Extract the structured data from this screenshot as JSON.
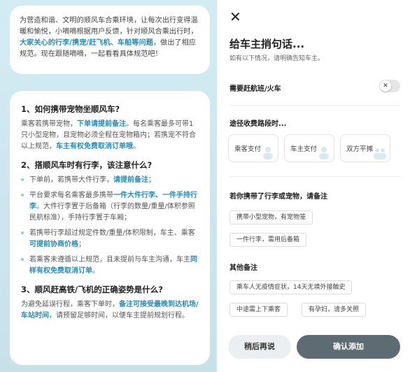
{
  "left": {
    "intro_parts": [
      "为营造和谐、文明的顺风车合乘环境，让每次出行变得温暖和愉悦，小嘀嘀根据用户反馈，针对顺风合乘出行时，",
      "大家关心的行李/携宠/赶飞机、车船等问题",
      "，做出了相应规范。现在跟随嘀嘀，一起看看具体规范吧！"
    ],
    "sections": [
      {
        "title": "1、如何携带宠物坐顺风车?",
        "parts": [
          {
            "t": "乘客若携带宠物，",
            "h": false
          },
          {
            "t": "下单请提前备注",
            "h": true
          },
          {
            "t": "。每名乘客最多可带1只小型宠物，且宠物必须全程在宠物箱内；若携宠不符合以上规范，",
            "h": false
          },
          {
            "t": "车主有权免费取消订单哦",
            "h": true
          },
          {
            "t": "。",
            "h": false
          }
        ]
      },
      {
        "title": "2、搭顺风车时有行李，该注意什么?",
        "bullets": [
          [
            {
              "t": "下单前，若携带大件行李，",
              "h": false
            },
            {
              "t": "请提前备注",
              "h": true
            },
            {
              "t": "；",
              "h": false
            }
          ],
          [
            {
              "t": "平台要求每名乘客最多携带",
              "h": false
            },
            {
              "t": "一件大件行李、一件手持行李",
              "h": true
            },
            {
              "t": "。大件行李置于后备箱（行李的数量/重量/体积参照民航标准），手持行李置于车厢；",
              "h": false
            }
          ],
          [
            {
              "t": "若携带行李超过规定件数/重量/体积限制，车主、乘客",
              "h": false
            },
            {
              "t": "可提前协商价格",
              "h": true
            },
            {
              "t": "；",
              "h": false
            }
          ],
          [
            {
              "t": "若乘客未遵循以上规范，且未提前与车主沟通，车主",
              "h": false
            },
            {
              "t": "同样有权免费取消订单",
              "h": true
            },
            {
              "t": "。",
              "h": false
            }
          ]
        ]
      },
      {
        "title": "3、顺风赶高铁/飞机的正确姿势是什么?",
        "parts": [
          {
            "t": "为避免延误行程，乘客下单时，",
            "h": false
          },
          {
            "t": "备注可接受最晚到达机场/车站时间",
            "h": true
          },
          {
            "t": "，请预留足够时间，以便车主提前规划行程。",
            "h": false
          }
        ]
      }
    ]
  },
  "right": {
    "close_glyph": "✕",
    "title": "给车主捎句话...",
    "subtitle": "如有以下情况，请明确告知车主。",
    "rush": {
      "label": "需要赶航班/火车",
      "toggle_glyph": "✕"
    },
    "toll": {
      "label": "途径收费路段时...",
      "options": [
        "乘客支付",
        "车主支付",
        "双方平摊"
      ]
    },
    "luggage": {
      "label": "若你携带了行李或宠物，请备注",
      "chips": [
        "携带小型宠物，有宠物笼",
        "一件行李，需用后备箱"
      ]
    },
    "other": {
      "label": "其他备注",
      "chips": [
        "乘车人无疫情症状，14天无境外接触史",
        "中途需上下乘客",
        "有孕妇，请多关照"
      ]
    },
    "buttons": {
      "later": "稍后再说",
      "confirm": "确认添加"
    }
  }
}
